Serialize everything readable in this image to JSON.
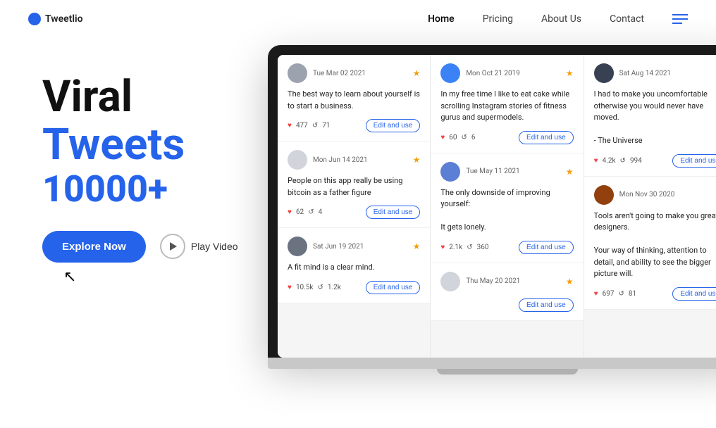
{
  "brand": {
    "name": "Tweetlio"
  },
  "navbar": {
    "links": [
      {
        "label": "Home",
        "active": true
      },
      {
        "label": "Pricing",
        "active": false
      },
      {
        "label": "About Us",
        "active": false
      },
      {
        "label": "Contact",
        "active": false
      }
    ]
  },
  "hero": {
    "line1": "Viral",
    "line2": "Tweets",
    "count": "10000+",
    "explore_label": "Explore Now",
    "play_label": "Play Video"
  },
  "tweets": {
    "col1": [
      {
        "date": "Tue Mar 02 2021",
        "avatar_style": "gray",
        "text": "The best way to learn about yourself is to start a business.",
        "likes": "477",
        "retweets": "71",
        "btn": "Edit and use"
      },
      {
        "date": "Mon Jun 14 2021",
        "avatar_style": "light",
        "text": "People on this app really be using bitcoin as a father figure",
        "likes": "62",
        "retweets": "4",
        "btn": "Edit and use"
      },
      {
        "date": "Sat Jun 19 2021",
        "avatar_style": "medium",
        "text": "A fit mind is a clear mind.",
        "likes": "10.5k",
        "retweets": "1.2k",
        "btn": "Edit and use"
      }
    ],
    "col2": [
      {
        "date": "Mon Oct 21 2019",
        "avatar_style": "blue",
        "text": "In my free time I like to eat cake while scrolling Instagram stories of fitness gurus and supermodels.",
        "likes": "60",
        "retweets": "6",
        "btn": "Edit and use"
      },
      {
        "date": "Tue May 11 2021",
        "avatar_style": "blue",
        "text": "The only downside of improving yourself:\n\nIt gets lonely.",
        "likes": "2.1k",
        "retweets": "360",
        "btn": "Edit and use"
      },
      {
        "date": "Thu May 20 2021",
        "avatar_style": "light",
        "text": "",
        "likes": "",
        "retweets": "",
        "btn": "Edit and use"
      }
    ],
    "col3": [
      {
        "date": "Sat Aug 14 2021",
        "avatar_style": "dark",
        "text": "I had to make you uncomfortable otherwise you would never have moved.\n\n- The Universe",
        "likes": "4.2k",
        "retweets": "994",
        "btn": "Edit and use"
      },
      {
        "date": "Mon Nov 30 2020",
        "avatar_style": "brown",
        "text": "Tools aren't going to make you great designers.\n\nYour way of thinking, attention to detail, and ability to see the bigger picture will.",
        "likes": "697",
        "retweets": "81",
        "btn": "Edit and use"
      }
    ]
  }
}
